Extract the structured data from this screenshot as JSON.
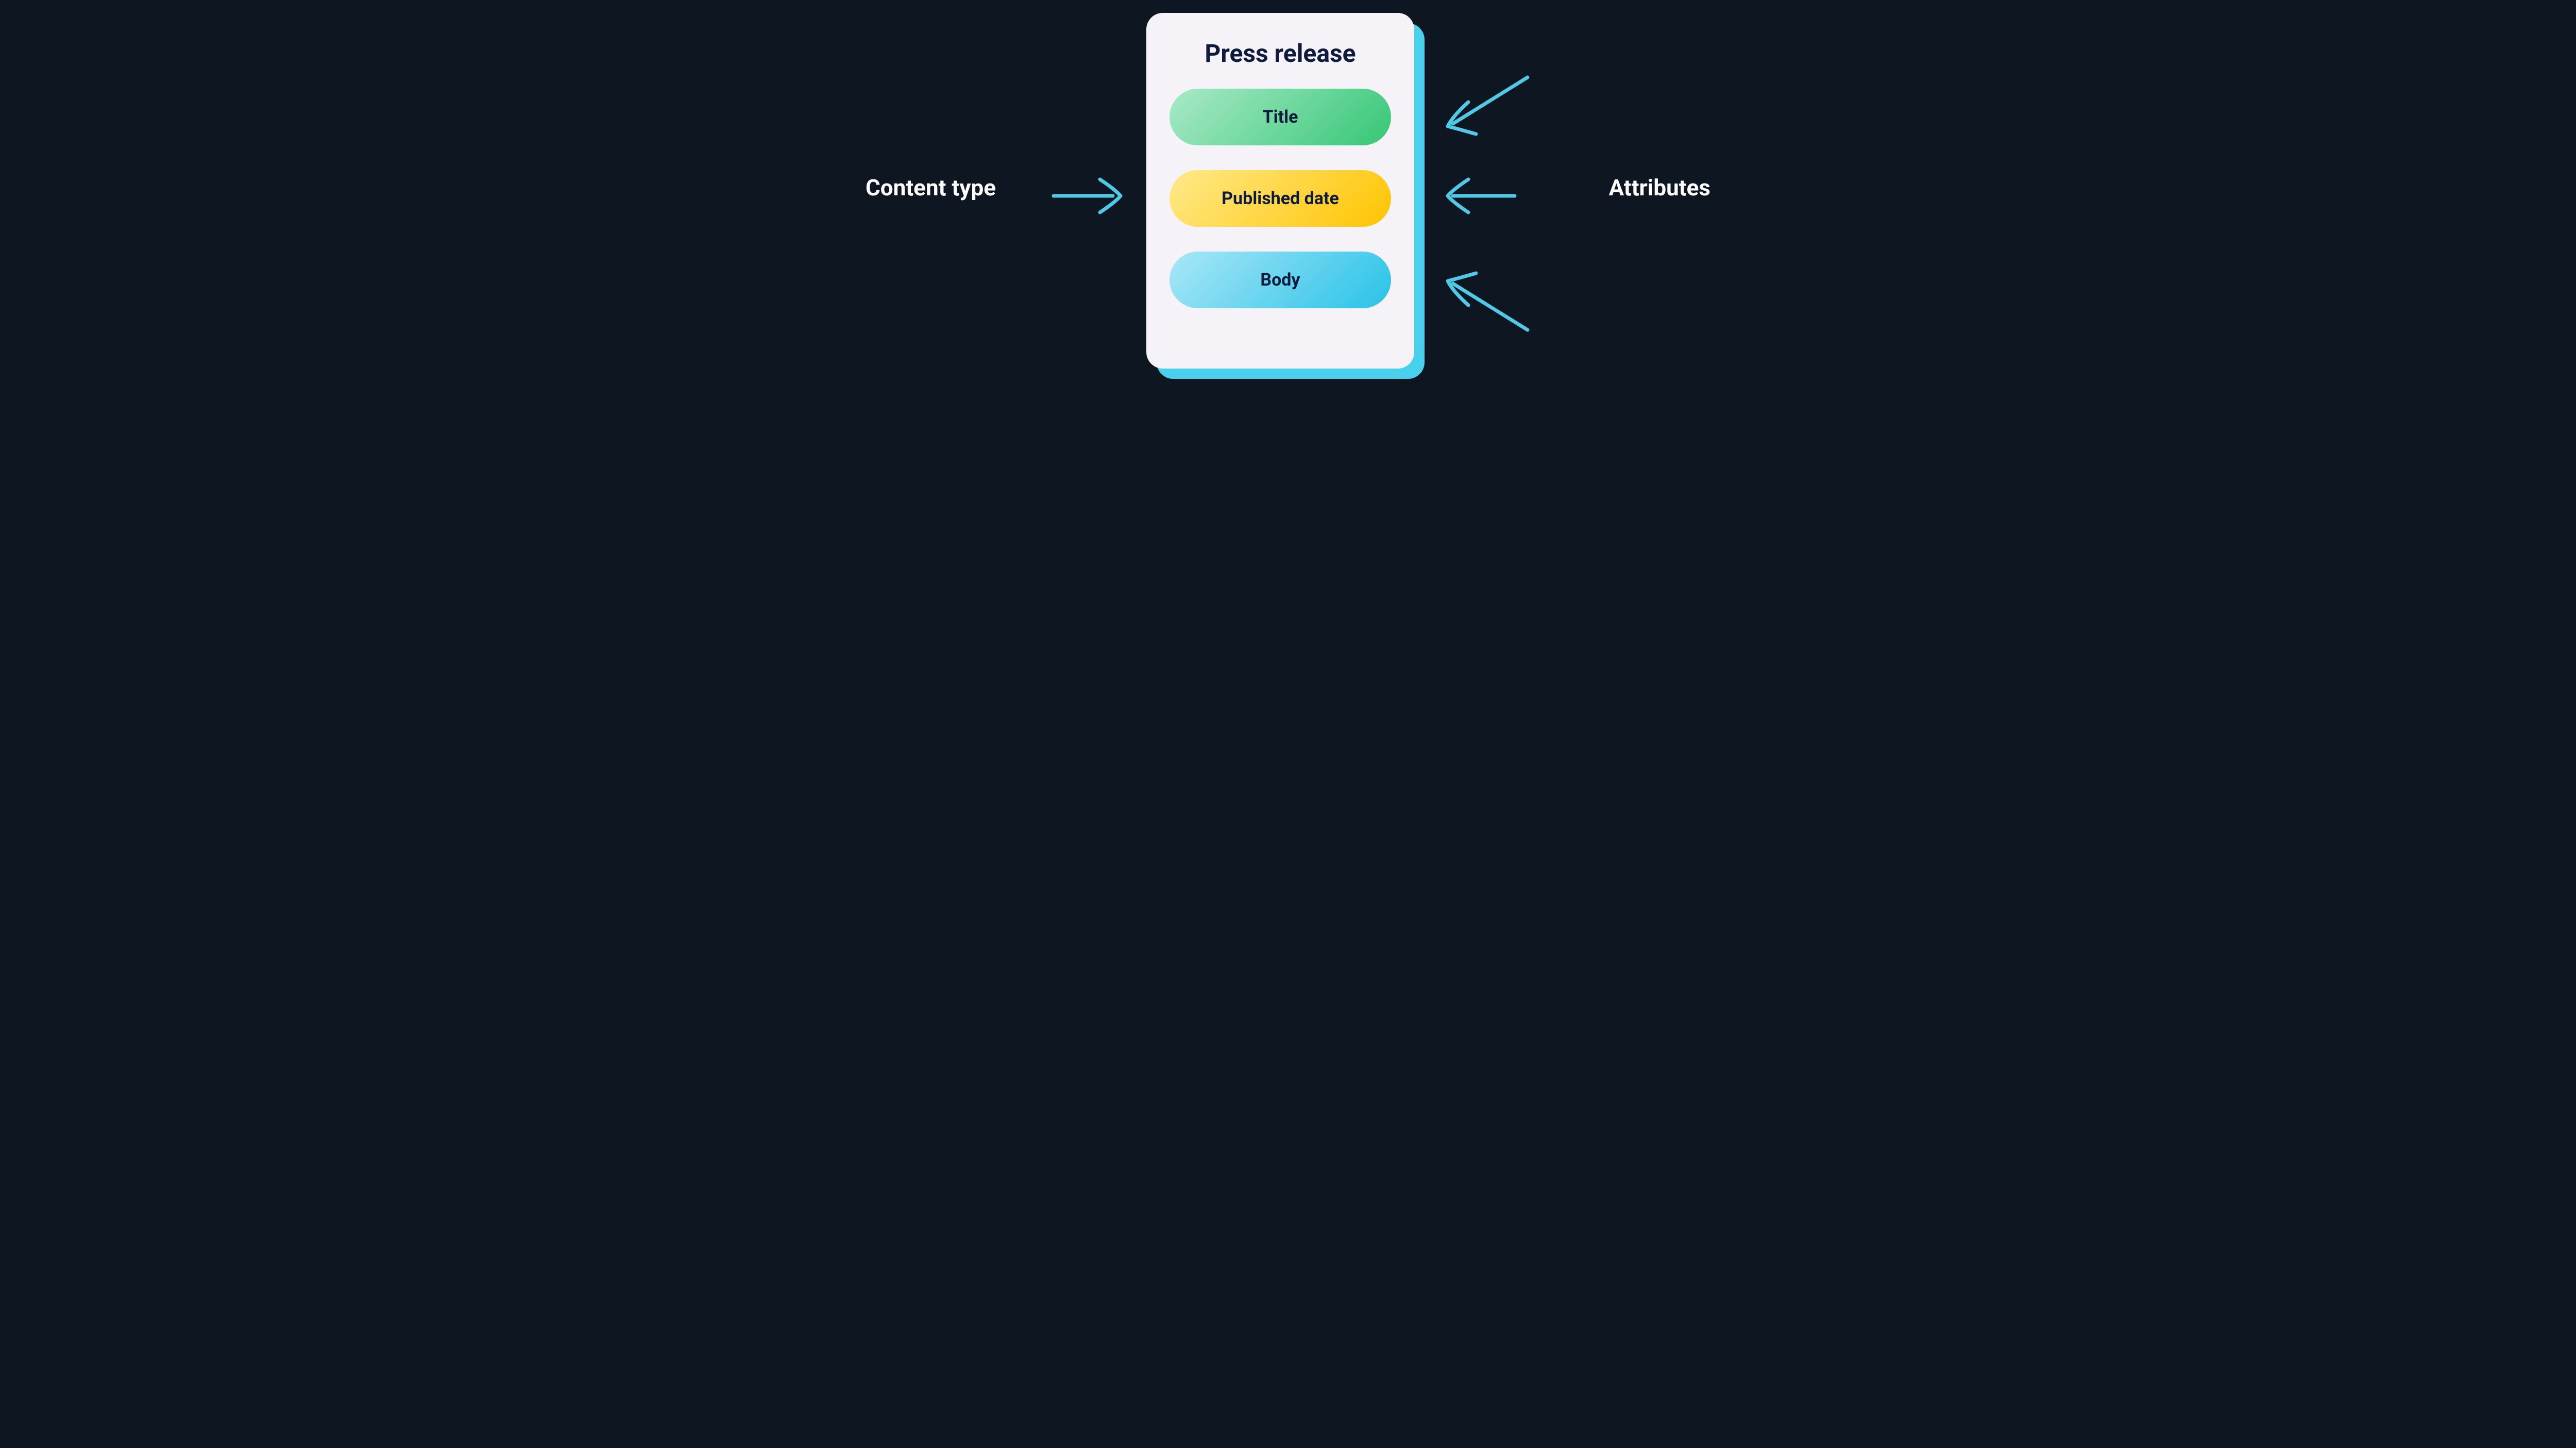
{
  "left_label": "Content type",
  "right_label": "Attributes",
  "card": {
    "title": "Press release",
    "attributes": [
      "Title",
      "Published date",
      "Body"
    ]
  }
}
